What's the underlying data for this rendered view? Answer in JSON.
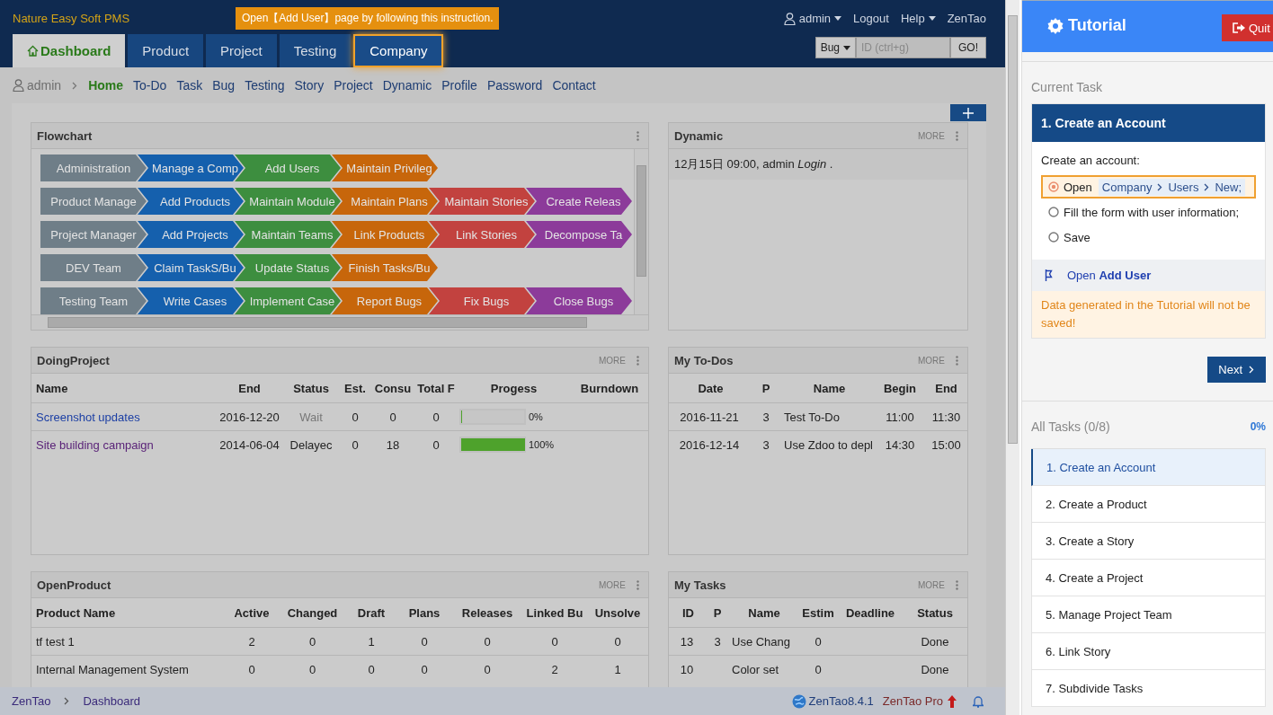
{
  "header": {
    "brand": "Nature Easy Soft PMS",
    "tooltip": "Open【Add User】page by following this instruction.",
    "user": "admin",
    "links": [
      "Logout",
      "Help",
      "ZenTao"
    ],
    "tabs": [
      {
        "label": "Dashboard",
        "selected": true,
        "highlighted": false
      },
      {
        "label": "Product",
        "selected": false,
        "highlighted": false
      },
      {
        "label": "Project",
        "selected": false,
        "highlighted": false
      },
      {
        "label": "Testing",
        "selected": false,
        "highlighted": false
      },
      {
        "label": "Company",
        "selected": false,
        "highlighted": true
      }
    ],
    "search": {
      "type": "Bug",
      "placeholder": "ID (ctrl+g)",
      "button": "GO!"
    }
  },
  "subnav": {
    "user": "admin",
    "items": [
      {
        "label": "Home",
        "selected": true
      },
      {
        "label": "To-Do",
        "selected": false
      },
      {
        "label": "Task",
        "selected": false
      },
      {
        "label": "Bug",
        "selected": false
      },
      {
        "label": "Testing",
        "selected": false
      },
      {
        "label": "Story",
        "selected": false
      },
      {
        "label": "Project",
        "selected": false
      },
      {
        "label": "Dynamic",
        "selected": false
      },
      {
        "label": "Profile",
        "selected": false
      },
      {
        "label": "Password",
        "selected": false
      },
      {
        "label": "Contact",
        "selected": false
      }
    ]
  },
  "flowchart": {
    "title": "Flowchart",
    "rows": [
      [
        {
          "label": "Administration",
          "color": "#6f7e88"
        },
        {
          "label": "Manage a Comp",
          "color": "#1560ad"
        },
        {
          "label": "Add Users",
          "color": "#3d8e3f"
        },
        {
          "label": "Maintain Privileg",
          "color": "#c7660b"
        }
      ],
      [
        {
          "label": "Product Manage",
          "color": "#6f7e88"
        },
        {
          "label": "Add Products",
          "color": "#1560ad"
        },
        {
          "label": "Maintain Module",
          "color": "#3d8e3f"
        },
        {
          "label": "Maintain Plans",
          "color": "#c7660b"
        },
        {
          "label": "Maintain Stories",
          "color": "#c2423f"
        },
        {
          "label": "Create Releas",
          "color": "#8c3b9a"
        }
      ],
      [
        {
          "label": "Project Manager",
          "color": "#6f7e88"
        },
        {
          "label": "Add Projects",
          "color": "#1560ad"
        },
        {
          "label": "Maintain Teams",
          "color": "#3d8e3f"
        },
        {
          "label": "Link Products",
          "color": "#c7660b"
        },
        {
          "label": "Link Stories",
          "color": "#c2423f"
        },
        {
          "label": "Decompose Ta",
          "color": "#8c3b9a"
        }
      ],
      [
        {
          "label": "DEV Team",
          "color": "#6f7e88"
        },
        {
          "label": "Claim TaskS/Bu",
          "color": "#1560ad"
        },
        {
          "label": "Update Status",
          "color": "#3d8e3f"
        },
        {
          "label": "Finish Tasks/Bu",
          "color": "#c7660b"
        }
      ],
      [
        {
          "label": "Testing Team",
          "color": "#6f7e88"
        },
        {
          "label": "Write Cases",
          "color": "#1560ad"
        },
        {
          "label": "Implement Case",
          "color": "#3d8e3f"
        },
        {
          "label": "Report Bugs",
          "color": "#c7660b"
        },
        {
          "label": "Fix Bugs",
          "color": "#c2423f"
        },
        {
          "label": "Close Bugs",
          "color": "#8c3b9a"
        }
      ]
    ]
  },
  "dynamic": {
    "title": "Dynamic",
    "more": "MORE",
    "entries": [
      "12月15日 09:00, admin *Login* ."
    ]
  },
  "doing_project": {
    "title": "DoingProject",
    "more": "MORE",
    "columns": [
      "Name",
      "End",
      "Status",
      "Est.",
      "Consu",
      "Total F",
      "Progess",
      "Burndown"
    ],
    "rows": [
      [
        {
          "kind": "link",
          "text": "Screenshot updates"
        },
        "2016-12-20",
        {
          "kind": "muted",
          "text": "Wait"
        },
        "0",
        "0",
        "0",
        {
          "kind": "progress",
          "level": 0,
          "text": "0%"
        },
        ""
      ],
      [
        {
          "kind": "visited",
          "text": "Site building campaign"
        },
        "2014-06-04",
        "Delayec",
        "0",
        "18",
        "0",
        {
          "kind": "progress",
          "level": 1,
          "text": "100%"
        },
        ""
      ]
    ]
  },
  "my_todos": {
    "title": "My To-Dos",
    "more": "MORE",
    "columns": [
      "Date",
      "P",
      "Name",
      "Begin",
      "End"
    ],
    "rows": [
      [
        "2016-11-21",
        "3",
        "Test To-Do",
        "11:00",
        "11:30"
      ],
      [
        "2016-12-14",
        "3",
        "Use Zdoo to depl",
        "14:30",
        "15:00"
      ]
    ]
  },
  "open_product": {
    "title": "OpenProduct",
    "more": "MORE",
    "columns": [
      "Product Name",
      "Active",
      "Changed",
      "Draft",
      "Plans",
      "Releases",
      "Linked Bu",
      "Unsolve"
    ],
    "rows": [
      [
        "tf test 1",
        "2",
        "0",
        "1",
        "0",
        "0",
        "0",
        "0"
      ],
      [
        "Internal Management System",
        "0",
        "0",
        "0",
        "0",
        "0",
        "2",
        "1"
      ]
    ]
  },
  "my_tasks": {
    "title": "My Tasks",
    "more": "MORE",
    "columns": [
      "ID",
      "P",
      "Name",
      "Estim",
      "Deadline",
      "Status"
    ],
    "rows": [
      [
        "13",
        "3",
        "Use Chang",
        "0",
        "",
        "Done"
      ],
      [
        "10",
        "",
        "Color set",
        "0",
        "",
        "Done"
      ]
    ]
  },
  "footer": {
    "crumbs": [
      "ZenTao",
      "Dashboard"
    ],
    "version": "ZenTao8.4.1",
    "pro": "ZenTao Pro"
  },
  "tutorial": {
    "title": "Tutorial",
    "quit": "Quit",
    "current_label": "Current Task",
    "task_title": "1. Create an Account",
    "intro": "Create an account:",
    "steps": [
      {
        "kind": "nav",
        "text": "Open",
        "path": [
          "Company",
          "Users",
          "New;"
        ],
        "active": true
      },
      {
        "kind": "text",
        "text": "Fill the form with user information;",
        "active": false
      },
      {
        "kind": "text",
        "text": "Save",
        "active": false
      }
    ],
    "open_link": "Open **Add User**",
    "warning": "Data generated in the Tutorial will not be saved!",
    "next": "Next",
    "all_tasks": "All Tasks (0/8)",
    "progress": "0%",
    "tasks": [
      {
        "label": "1. Create an Account",
        "selected": true
      },
      {
        "label": "2. Create a Product",
        "selected": false
      },
      {
        "label": "3. Create a Story",
        "selected": false
      },
      {
        "label": "4. Create a Project",
        "selected": false
      },
      {
        "label": "5. Manage Project Team",
        "selected": false
      },
      {
        "label": "6. Link Story",
        "selected": false
      },
      {
        "label": "7. Subdivide Tasks",
        "selected": false
      }
    ]
  }
}
